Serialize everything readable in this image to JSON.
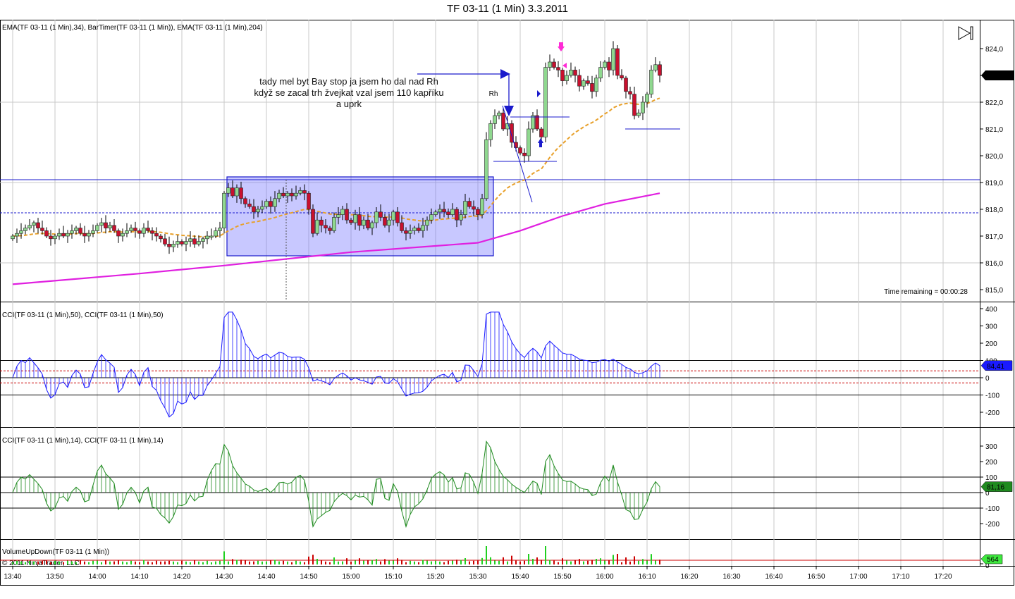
{
  "window": {
    "title": "TF 03-11 (1 Min)  3.3.2011"
  },
  "panels": {
    "price_label": "EMA(TF 03-11 (1 Min),34), BarTimer(TF 03-11 (1 Min)), EMA(TF 03-11 (1 Min),204)",
    "cci50_label": "CCI(TF 03-11 (1 Min),50), CCI(TF 03-11 (1 Min),50)",
    "cci14_label": "CCI(TF 03-11 (1 Min),14), CCI(TF 03-11 (1 Min),14)",
    "volume_label": "VolumeUpDown(TF 03-11 (1 Min))",
    "copyright": "© 2011 NinjaTrader, LLC",
    "time_remaining": "Time remaining = 00:00:28"
  },
  "annotations": {
    "note_lines": [
      "tady mel byt Bay stop ja jsem ho dal nad Rh",
      "když se zacal trh žvejkat vzal jsem 110 kapříku",
      "a uprk"
    ],
    "rh": "Rh"
  },
  "colors": {
    "up": "#8fd88f",
    "down": "#c8102e",
    "ema34": "#e8a02a",
    "ema204": "#e020e0",
    "cci50": "#1a1aff",
    "cci14": "#1f8a1f",
    "drawing": "#1a1acc"
  },
  "chart_data": {
    "type": "candlestick",
    "instrument": "TF 03-11 (1 Min)",
    "price_axis": {
      "ticks": [
        "824,0",
        "823,0",
        "822,0",
        "821,0",
        "820,0",
        "819,0",
        "818,0",
        "817,0",
        "816,0",
        "815,0"
      ],
      "min": 815,
      "max": 824
    },
    "last_price_label": "823,0",
    "time_ticks": [
      "13:40",
      "13:50",
      "14:00",
      "14:10",
      "14:20",
      "14:30",
      "14:40",
      "14:50",
      "15:00",
      "15:10",
      "15:20",
      "15:30",
      "15:40",
      "15:50",
      "16:00",
      "16:10",
      "16:20",
      "16:30",
      "16:40",
      "16:50",
      "17:00",
      "17:10",
      "17:20"
    ],
    "start_time": "13:40",
    "closes": [
      817.0,
      817.1,
      817.2,
      817.3,
      817.4,
      817.5,
      817.3,
      817.2,
      817.0,
      816.9,
      817.0,
      817.1,
      817.0,
      817.1,
      817.2,
      817.3,
      817.1,
      817.0,
      817.1,
      817.2,
      817.4,
      817.5,
      817.3,
      817.4,
      817.2,
      817.0,
      817.1,
      817.2,
      817.3,
      817.2,
      817.1,
      817.3,
      817.2,
      817.1,
      817.0,
      816.9,
      816.7,
      816.6,
      816.7,
      816.8,
      816.7,
      816.8,
      816.9,
      816.7,
      816.8,
      816.9,
      817.0,
      817.0,
      817.2,
      817.3,
      818.6,
      818.8,
      818.5,
      818.8,
      818.4,
      818.2,
      818.1,
      817.9,
      818.0,
      818.1,
      818.3,
      818.1,
      818.4,
      818.6,
      818.5,
      818.6,
      818.5,
      818.6,
      818.7,
      818.6,
      818.0,
      817.1,
      817.6,
      817.4,
      817.3,
      817.2,
      817.7,
      817.8,
      818.0,
      817.6,
      817.5,
      817.8,
      817.4,
      817.6,
      817.3,
      817.5,
      817.9,
      817.7,
      817.4,
      817.6,
      817.9,
      817.5,
      817.2,
      817.1,
      817.2,
      817.3,
      817.2,
      817.4,
      817.6,
      817.8,
      817.9,
      818.0,
      817.9,
      817.8,
      818.0,
      817.6,
      817.8,
      818.3,
      818.1,
      818.0,
      817.8,
      818.4,
      820.6,
      821.2,
      821.5,
      821.6,
      821.0,
      821.2,
      820.5,
      820.3,
      820.1,
      820.0,
      821.0,
      821.5,
      821.0,
      820.7,
      823.3,
      823.5,
      823.3,
      823.2,
      822.8,
      823.0,
      823.2,
      823.0,
      822.6,
      822.8,
      822.7,
      822.4,
      822.9,
      823.3,
      823.5,
      823.2,
      824.0,
      823.0,
      822.9,
      822.4,
      822.3,
      821.5,
      821.6,
      822.0,
      822.3,
      823.2,
      823.4,
      823.0
    ],
    "ema204_points": [
      [
        0,
        815.2
      ],
      [
        30,
        815.6
      ],
      [
        50,
        815.9
      ],
      [
        80,
        816.4
      ],
      [
        110,
        816.75
      ],
      [
        120,
        817.2
      ],
      [
        130,
        817.75
      ],
      [
        140,
        818.2
      ],
      [
        153,
        818.6
      ]
    ],
    "cci50": {
      "axis_ticks": [
        "400",
        "300",
        "200",
        "100",
        "0",
        "-100",
        "-200"
      ],
      "last_value_label": "84,41"
    },
    "cci14": {
      "axis_ticks": [
        "300",
        "200",
        "100",
        "0",
        "-100",
        "-200"
      ],
      "last_value_label": "81,16"
    },
    "volume": {
      "axis_tick": "0",
      "last_value_label": "564"
    }
  }
}
